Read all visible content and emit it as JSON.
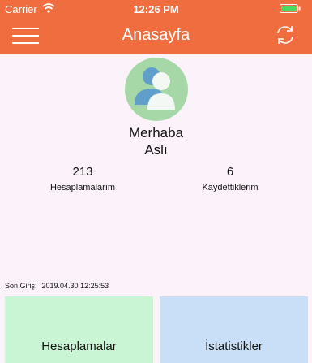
{
  "status_bar": {
    "carrier": "Carrier",
    "time": "12:26 PM"
  },
  "nav": {
    "title": "Anasayfa",
    "menu_icon": "hamburger-menu-icon",
    "refresh_icon": "refresh-icon"
  },
  "profile": {
    "greeting": "Merhaba",
    "name": "Aslı",
    "avatar_icon": "users-icon"
  },
  "stats": [
    {
      "value": "213",
      "label": "Hesaplamalarım"
    },
    {
      "value": "6",
      "label": "Kaydettiklerim"
    }
  ],
  "last_login": {
    "label": "Son Giriş:",
    "value": "2019.04.30 12:25:53"
  },
  "tiles": [
    {
      "label": "Hesaplamalar",
      "color": "#c9f5d4"
    },
    {
      "label": "İstatistikler",
      "color": "#c9dff7"
    }
  ],
  "colors": {
    "header": "#f06d3f",
    "background": "#fbf3f9",
    "avatar_bg": "#a6d8a7",
    "battery": "#4cd964"
  }
}
